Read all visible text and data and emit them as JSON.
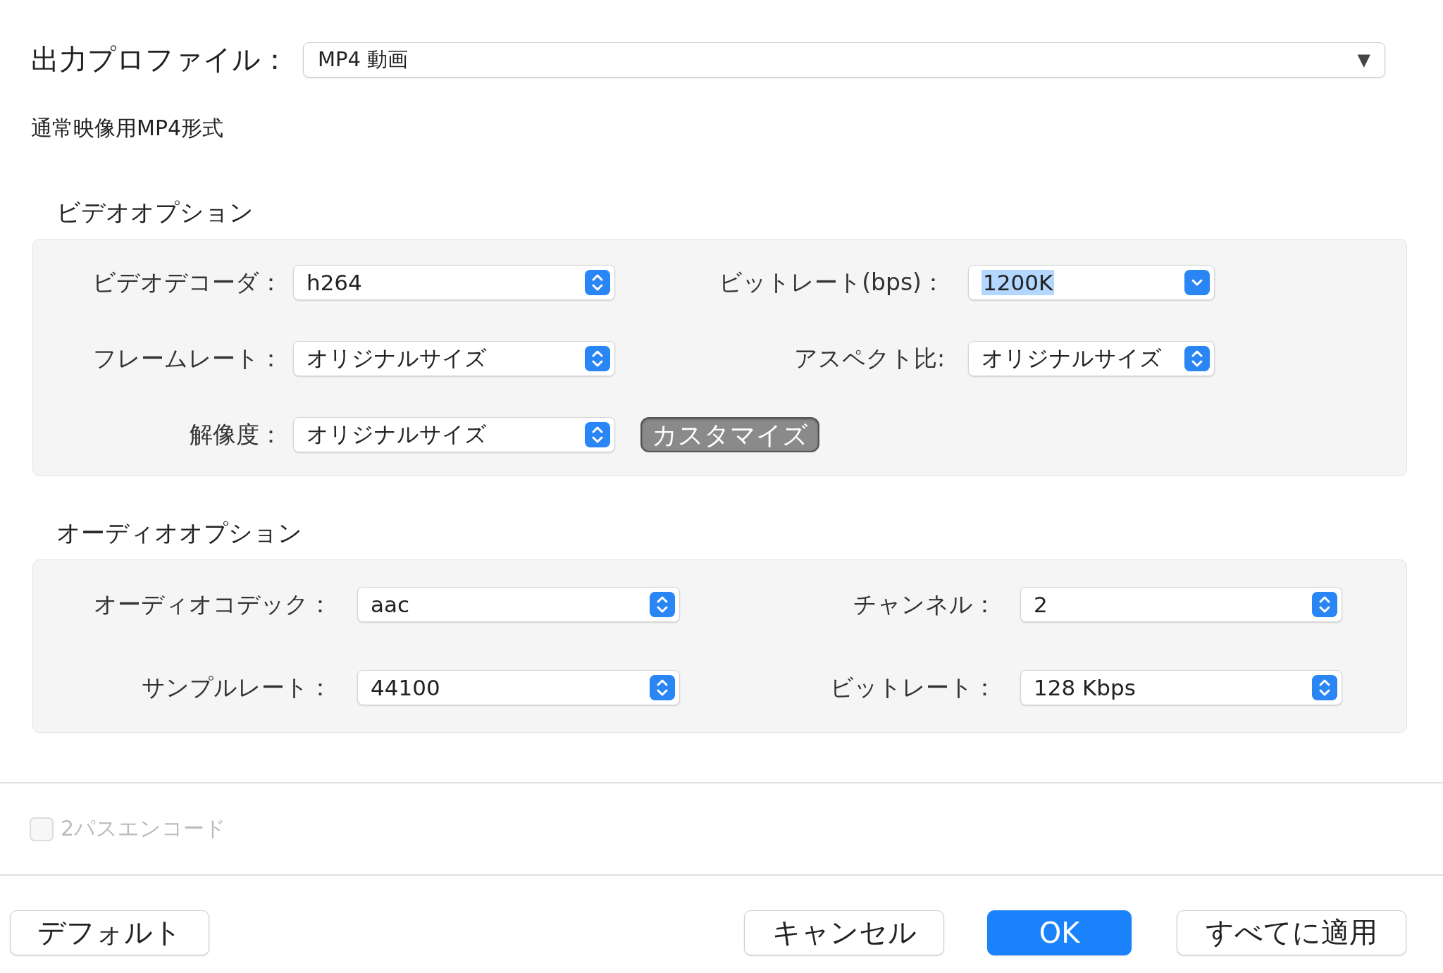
{
  "profile": {
    "label": "出力プロファイル：",
    "value": "MP4 動画",
    "arrow": "▼"
  },
  "description": "通常映像用MP4形式",
  "video_options": {
    "title": "ビデオオプション",
    "fields": [
      {
        "label": "ビデオデコーダ：",
        "value": "h264",
        "kind": "popup"
      },
      {
        "label": "ビットレート(bps)：",
        "value": "1200K",
        "kind": "combo",
        "highlighted": true
      },
      {
        "label": "フレームレート：",
        "value": "オリジナルサイズ",
        "kind": "popup"
      },
      {
        "label": "アスペクト比:",
        "value": "オリジナルサイズ",
        "kind": "popup"
      },
      {
        "label": "解像度：",
        "value": "オリジナルサイズ",
        "kind": "popup"
      }
    ],
    "customize_button": {
      "label": "カスタマイズ",
      "pressed": true
    }
  },
  "audio_options": {
    "title": "オーディオオプション",
    "fields": [
      {
        "label": "オーディオコデック：",
        "value": "aac",
        "kind": "popup"
      },
      {
        "label": "チャンネル：",
        "value": "2",
        "kind": "popup"
      },
      {
        "label": "サンプルレート：",
        "value": "44100",
        "kind": "popup"
      },
      {
        "label": "ビットレート：",
        "value": "128 Kbps",
        "kind": "popup"
      }
    ]
  },
  "two_pass": {
    "label": "2パスエンコード",
    "checked": false,
    "disabled": true
  },
  "buttons": [
    {
      "label": "デフォルト",
      "default": false
    },
    {
      "label": "キャンセル",
      "default": false
    },
    {
      "label": "OK",
      "default": true
    },
    {
      "label": "すべてに適用",
      "default": false
    }
  ]
}
